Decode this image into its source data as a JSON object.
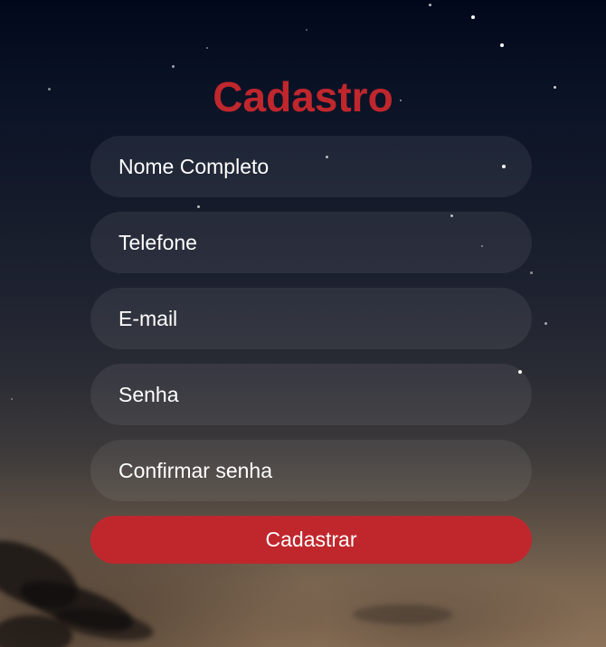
{
  "form": {
    "title": "Cadastro",
    "fields": [
      {
        "placeholder": "Nome Completo"
      },
      {
        "placeholder": "Telefone"
      },
      {
        "placeholder": "E-mail"
      },
      {
        "placeholder": "Senha"
      },
      {
        "placeholder": "Confirmar senha"
      }
    ],
    "submit_label": "Cadastrar"
  },
  "colors": {
    "accent": "#c0272d",
    "text": "#ffffff",
    "field_background": "rgba(255,255,255,0.07)"
  }
}
